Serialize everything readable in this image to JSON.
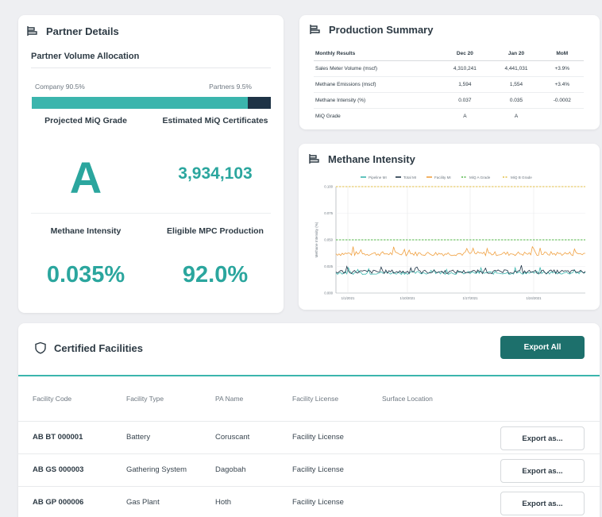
{
  "partner_details": {
    "title": "Partner Details",
    "volume_allocation_title": "Partner Volume Allocation",
    "company_label": "Company 90.5%",
    "partners_label": "Partners 9.5%",
    "company_share": 0.905,
    "projected_grade_label": "Projected MiQ Grade",
    "projected_grade_value": "A",
    "certificates_label": "Estimated MiQ Certificates",
    "certificates_value": "3,934,103",
    "methane_intensity_label": "Methane Intensity",
    "methane_intensity_value": "0.035%",
    "mpc_label": "Eligible MPC Production",
    "mpc_value": "92.0%"
  },
  "production_summary": {
    "title": "Production Summary",
    "headers": [
      "Monthly Results",
      "Dec 20",
      "Jan 20",
      "MoM"
    ],
    "rows": [
      [
        "Sales Meter Volume (mscf)",
        "4,310,241",
        "4,441,031",
        "+3.9%"
      ],
      [
        "Methane Emissions (mscf)",
        "1,594",
        "1,554",
        "+3.4%"
      ],
      [
        "Methane Intensity  (%)",
        "0.037",
        "0.035",
        "-0.0002"
      ],
      [
        "MiQ Grade",
        "A",
        "A",
        ""
      ]
    ]
  },
  "methane_intensity": {
    "title": "Methane Intensity"
  },
  "chart_data": {
    "type": "line",
    "title": "",
    "ylabel": "Methane Intensity (%)",
    "xlabel": "",
    "ylim": [
      0,
      0.1
    ],
    "y_ticks": [
      "0.000",
      "0.025",
      "0.050",
      "0.075",
      "0.100"
    ],
    "x_ticks": [
      "1/1/2021",
      "1/10/2021",
      "1/17/2021",
      "1/24/2021"
    ],
    "legend": [
      "Pipeline MI",
      "Total MI",
      "Facility MI",
      "MiQ A Grade",
      "MiQ B Grade"
    ],
    "legend_placement": "top",
    "grid": true,
    "colors": {
      "pipeline": "#3bb5ad",
      "total": "#1e3346",
      "facility": "#f0a040",
      "a_grade": "#55b84a",
      "b_grade": "#e3c04a"
    },
    "series": [
      {
        "name": "Pipeline MI",
        "approx_level": 0.019,
        "noise": 0.0015
      },
      {
        "name": "Total MI",
        "approx_level": 0.02,
        "noise": 0.0018
      },
      {
        "name": "Facility MI",
        "approx_level": 0.037,
        "noise": 0.002
      },
      {
        "name": "MiQ A Grade",
        "constant": 0.05
      },
      {
        "name": "MiQ B Grade",
        "constant": 0.1
      }
    ]
  },
  "certified_facilities": {
    "title": "Certified Facilities",
    "export_all_label": "Export All",
    "headers": [
      "Facility Code",
      "Facility Type",
      "PA Name",
      "Facility License",
      "Surface Location"
    ],
    "export_as_label": "Export as...",
    "rows": [
      {
        "code": "AB BT 000001",
        "type": "Battery",
        "pa": "Coruscant",
        "license": "Facility License"
      },
      {
        "code": "AB GS 000003",
        "type": "Gathering System",
        "pa": "Dagobah",
        "license": "Facility License"
      },
      {
        "code": "AB GP 000006",
        "type": "Gas Plant",
        "pa": "Hoth",
        "license": "Facility License"
      }
    ]
  }
}
